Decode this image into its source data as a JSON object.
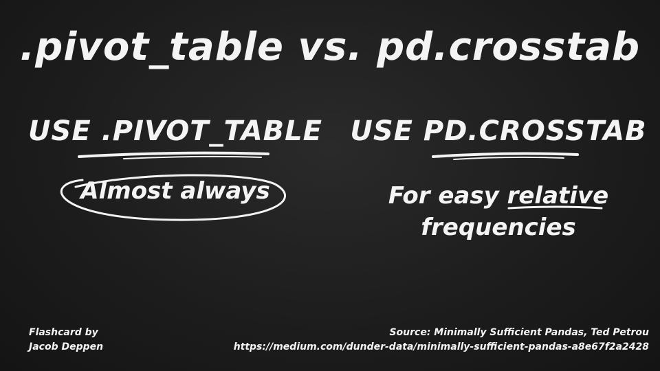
{
  "slide": {
    "title": ".pivot_table vs. pd.crosstab",
    "left": {
      "heading": "USE .PIVOT_TABLE",
      "body": "Almost always"
    },
    "right": {
      "heading": "USE PD.CROSSTAB",
      "body_before": "For easy ",
      "body_emphasis": "relative",
      "body_line2": "frequencies"
    }
  },
  "footer": {
    "credit_line1": "Flashcard by",
    "credit_line2": "Jacob Deppen",
    "source_line1": "Source: Minimally Sufficient Pandas, Ted Petrou",
    "source_line2": "https://medium.com/dunder-data/minimally-sufficient-pandas-a8e67f2a2428"
  },
  "colors": {
    "chalk": "#f4f4f4",
    "board": "#1c1c1c"
  }
}
